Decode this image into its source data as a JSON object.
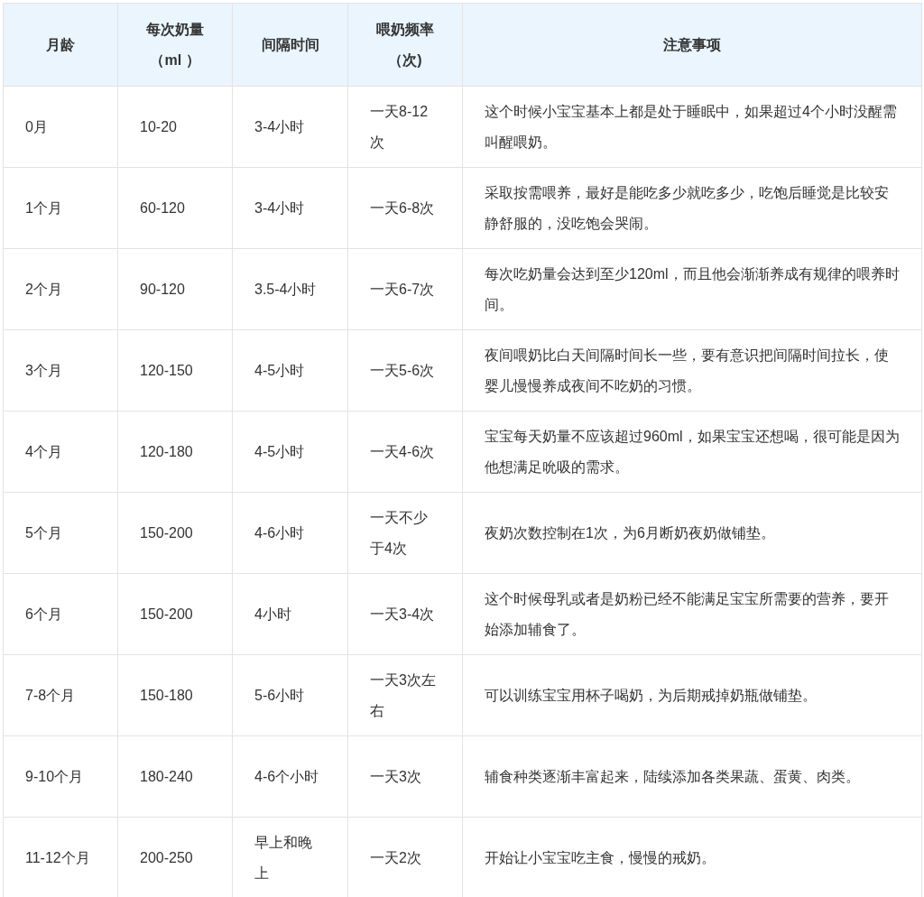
{
  "table": {
    "columns": [
      "月龄",
      "每次奶量（ml ）",
      "间隔时间",
      "喂奶频率（次)",
      "注意事项"
    ],
    "rows": [
      [
        "0月",
        "10-20",
        "3-4小时",
        "一天8-12次",
        "这个时候小宝宝基本上都是处于睡眠中，如果超过4个小时没醒需叫醒喂奶。"
      ],
      [
        "1个月",
        "60-120",
        "3-4小时",
        "一天6-8次",
        "采取按需喂养，最好是能吃多少就吃多少，吃饱后睡觉是比较安静舒服的，没吃饱会哭闹。"
      ],
      [
        "2个月",
        "90-120",
        "3.5-4小时",
        "一天6-7次",
        "每次吃奶量会达到至少120ml，而且他会渐渐养成有规律的喂养时间。"
      ],
      [
        "3个月",
        "120-150",
        "4-5小时",
        "一天5-6次",
        "夜间喂奶比白天间隔时间长一些，要有意识把间隔时间拉长，使婴儿慢慢养成夜间不吃奶的习惯。"
      ],
      [
        "4个月",
        "120-180",
        "4-5小时",
        "一天4-6次",
        "宝宝每天奶量不应该超过960ml，如果宝宝还想喝，很可能是因为他想满足吮吸的需求。"
      ],
      [
        "5个月",
        "150-200",
        "4-6小时",
        "一天不少于4次",
        "夜奶次数控制在1次，为6月断奶夜奶做铺垫。"
      ],
      [
        "6个月",
        "150-200",
        "4小时",
        "一天3-4次",
        "这个时候母乳或者是奶粉已经不能满足宝宝所需要的营养，要开始添加辅食了。"
      ],
      [
        "7-8个月",
        "150-180",
        "5-6小时",
        "一天3次左右",
        "可以训练宝宝用杯子喝奶，为后期戒掉奶瓶做铺垫。"
      ],
      [
        "9-10个月",
        "180-240",
        "4-6个小时",
        "一天3次",
        "辅食种类逐渐丰富起来，陆续添加各类果蔬、蛋黄、肉类。"
      ],
      [
        "11-12个月",
        "200-250",
        "早上和晚上",
        "一天2次",
        "开始让小宝宝吃主食，慢慢的戒奶。"
      ]
    ]
  }
}
